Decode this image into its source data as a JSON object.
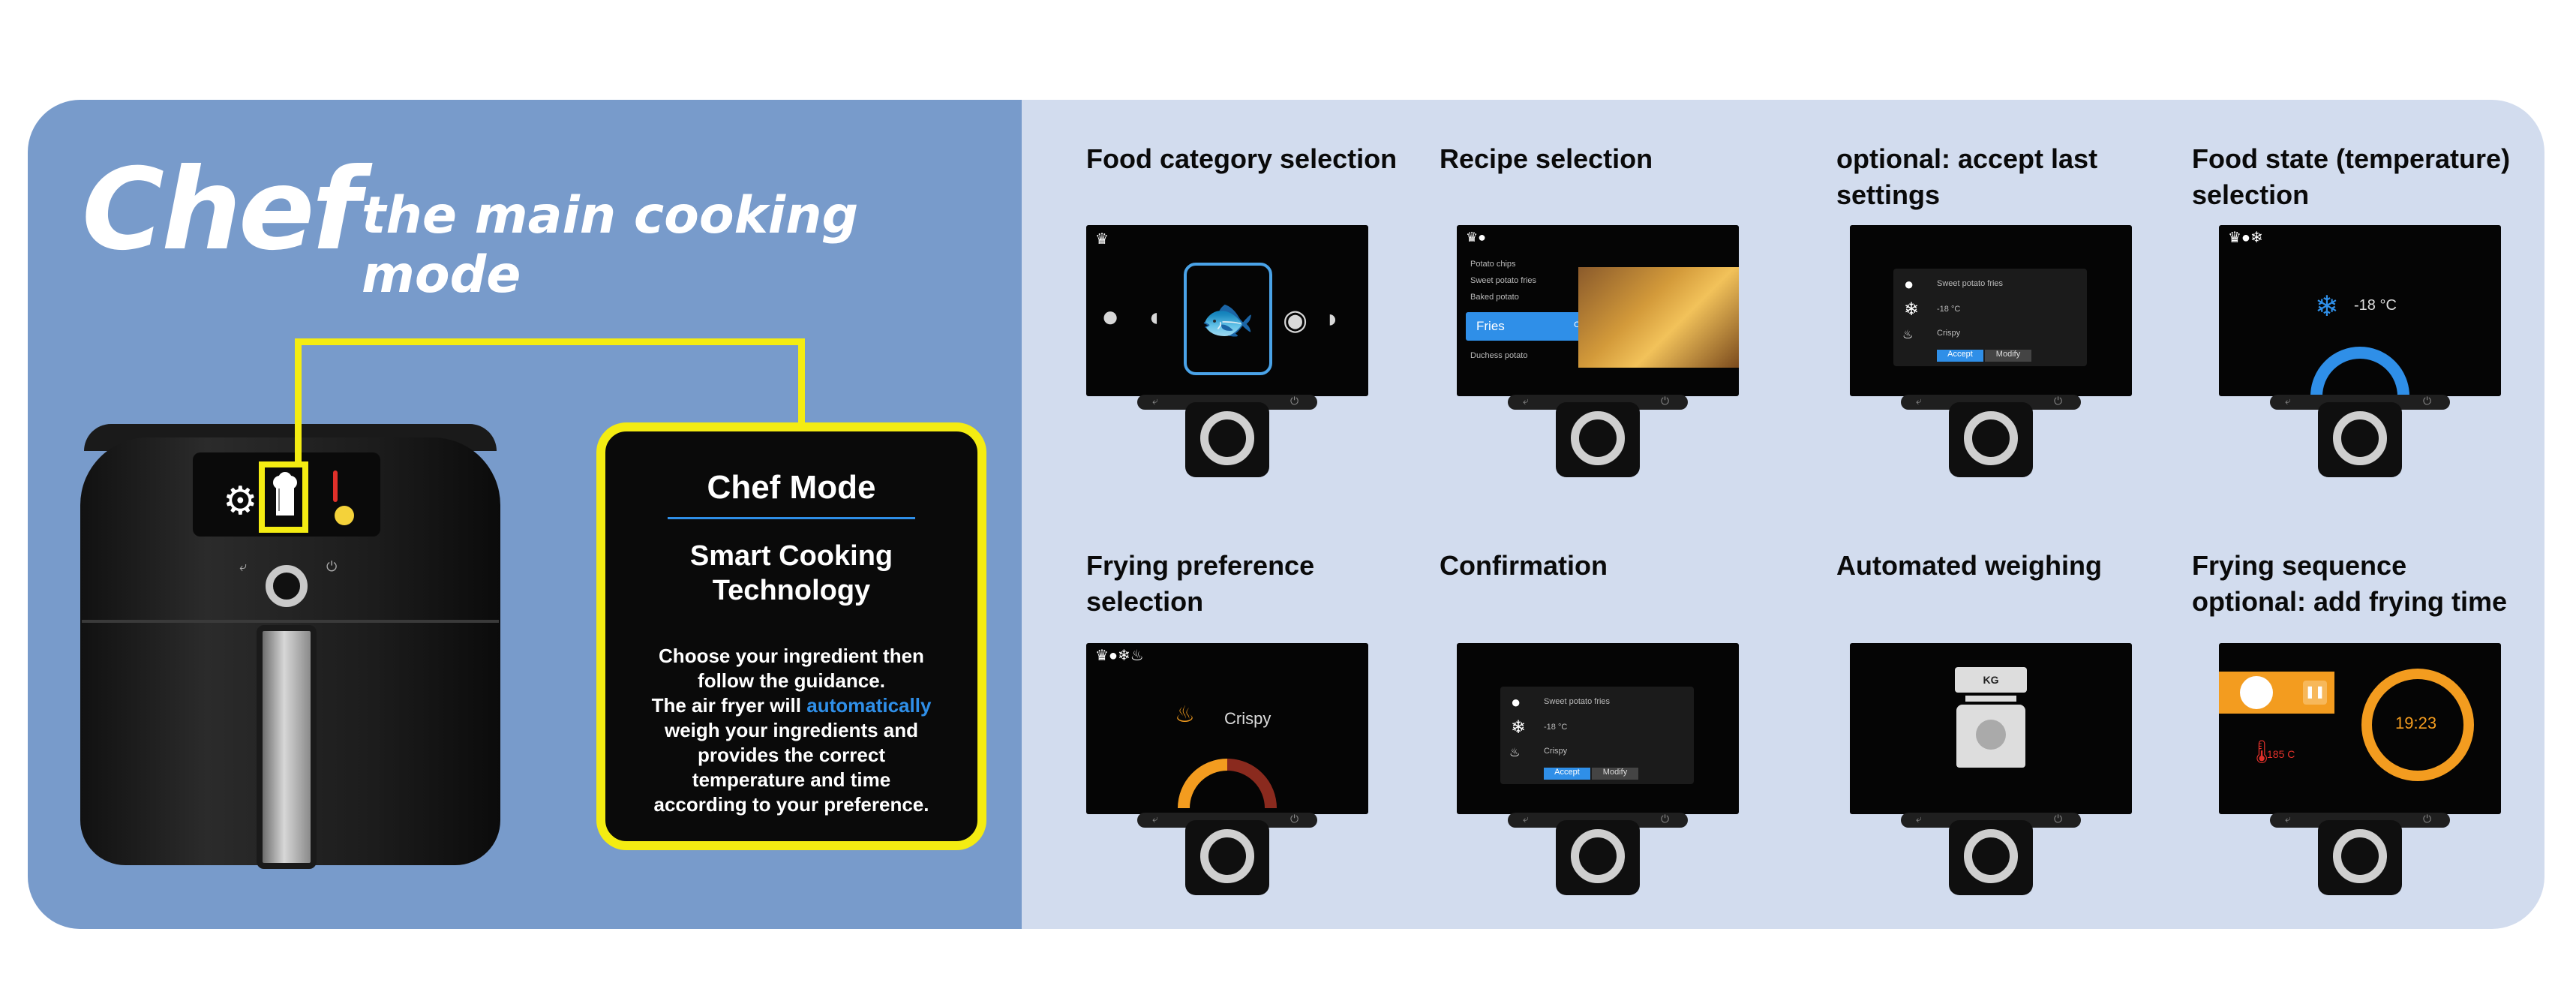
{
  "header": {
    "title": "Chef",
    "subtitle": "the main cooking mode"
  },
  "chef_box": {
    "heading": "Chef Mode",
    "subheading_line1": "Smart Cooking",
    "subheading_line2": "Technology",
    "desc_line1": "Choose your ingredient then",
    "desc_line2": "follow the guidance.",
    "desc_line3_pre": "The air fryer will ",
    "desc_line3_highlight": "automatically",
    "desc_line4": "weigh your ingredients and",
    "desc_line5": "provides the correct",
    "desc_line6": "temperature and time",
    "desc_line7": "according to your preference."
  },
  "steps": {
    "s1": {
      "title": "Food category selection"
    },
    "s2": {
      "title": "Recipe selection",
      "items": [
        "Potato chips",
        "Sweet potato fries",
        "Baked potato",
        "Fries",
        "Duchess potato"
      ],
      "ok": "OK"
    },
    "s3": {
      "title_line1": "optional: accept last",
      "title_line2": "settings"
    },
    "s4": {
      "title_line1": "Food state (temperature)",
      "title_line2": "selection",
      "temp": "-18 °C"
    },
    "s5": {
      "title_line1": "Frying preference",
      "title_line2": "selection",
      "preference": "Crispy"
    },
    "s6": {
      "title": "Confirmation"
    },
    "s7": {
      "title": "Automated weighing",
      "kg": "KG"
    },
    "s8": {
      "title_line1": "Frying sequence",
      "title_line2": "optional: add frying time",
      "time": "19:23",
      "temp": "185 C"
    }
  },
  "settings_card": {
    "food": "Sweet potato fries",
    "temp": "-18 °C",
    "pref": "Crispy",
    "accept": "Accept",
    "modify": "Modify"
  },
  "colors": {
    "banner": "#d2dcee",
    "left_panel": "#789bcb",
    "highlight": "#f4ec12",
    "accent": "#2f8fe8",
    "orange": "#f39c1f"
  },
  "icons": [
    "gear-icon",
    "chef-hat-icon",
    "thermometer-icon",
    "fish-icon",
    "snowflake-icon",
    "back-icon",
    "power-icon",
    "pause-icon",
    "clock-icon"
  ]
}
